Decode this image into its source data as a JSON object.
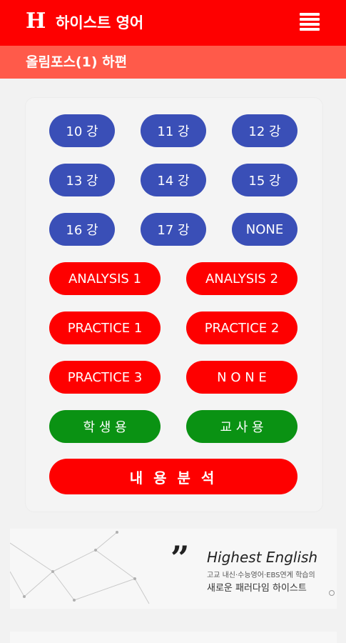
{
  "header": {
    "logo": "H",
    "title": "하이스트 영어",
    "menu_icon": "hamburger-menu-icon"
  },
  "subheader": {
    "title": "올림포스(1) 하편"
  },
  "lessons": [
    "10 강",
    "11 강",
    "12 강",
    "13 강",
    "14 강",
    "15 강",
    "16 강",
    "17 강",
    "NONE"
  ],
  "practice": [
    "ANALYSIS 1",
    "ANALYSIS 2",
    "PRACTICE 1",
    "PRACTICE 2",
    "PRACTICE 3",
    "N O N E"
  ],
  "roles": {
    "student": "학 생 용",
    "teacher": "교 사 용"
  },
  "analysis_button": "내 용 분 석",
  "banner": {
    "headline": "Highest English",
    "line1": "고교 내신·수능영어·EBS연계 학습의",
    "line2": "새로운 패러다임 하이스트"
  },
  "colors": {
    "header": "#fe0000",
    "subheader": "#ff5a4a",
    "lesson": "#3a4fb7",
    "practice": "#fe0000",
    "role": "#0a9213"
  }
}
